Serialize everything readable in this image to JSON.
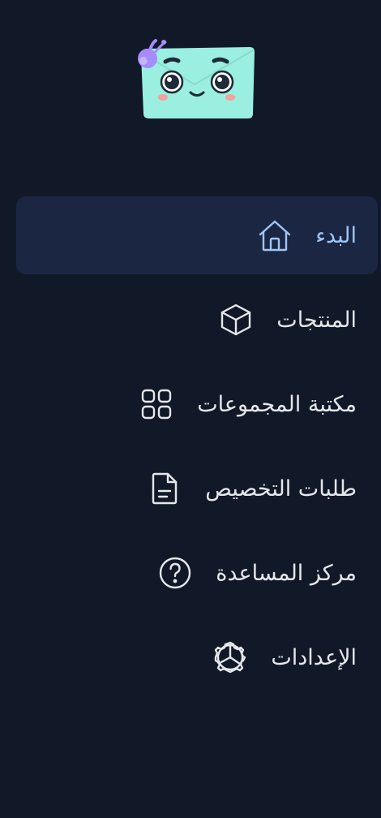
{
  "brand": {
    "logo_icon": "smiling-envelope-mascot-logo"
  },
  "colors": {
    "background": "#111827",
    "active_bg": "#1b2742",
    "active_text": "#9ec5f8",
    "text": "#e5e7eb",
    "mascot": "#9aefe0",
    "accent_purple": "#a78bfa"
  },
  "nav": {
    "items": [
      {
        "label": "البدء",
        "icon": "home-icon",
        "active": true
      },
      {
        "label": "المنتجات",
        "icon": "cube-icon",
        "active": false
      },
      {
        "label": "مكتبة المجموعات",
        "icon": "grid-icon",
        "active": false
      },
      {
        "label": "طلبات التخصيص",
        "icon": "document-icon",
        "active": false
      },
      {
        "label": "مركز المساعدة",
        "icon": "help-circle-icon",
        "active": false
      },
      {
        "label": "الإعدادات",
        "icon": "gear-icon",
        "active": false
      }
    ]
  }
}
